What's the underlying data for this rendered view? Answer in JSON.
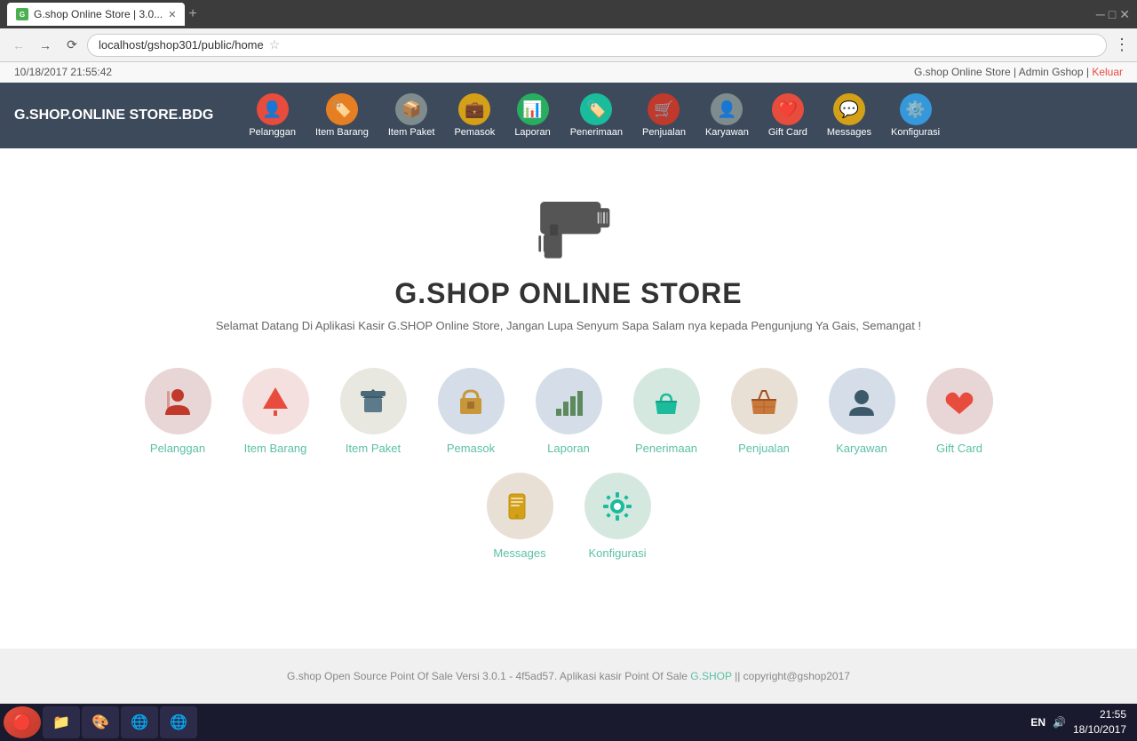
{
  "browser": {
    "tab_title": "G.shop Online Store | 3.0...",
    "tab_favicon": "G",
    "address": "localhost/gshop301/public/home"
  },
  "topbar": {
    "datetime": "10/18/2017 21:55:42",
    "site_info": "G.shop Online Store | Admin Gshop |",
    "logout_label": "Keluar"
  },
  "nav": {
    "brand": "G.SHOP.ONLINE STORE.BDG",
    "items": [
      {
        "id": "pelanggan",
        "label": "Pelanggan",
        "icon": "👤",
        "color": "#e74c3c"
      },
      {
        "id": "item-barang",
        "label": "Item Barang",
        "icon": "🏷️",
        "color": "#e67e22"
      },
      {
        "id": "item-paket",
        "label": "Item Paket",
        "icon": "📦",
        "color": "#7f8c8d"
      },
      {
        "id": "pemasok",
        "label": "Pemasok",
        "icon": "💼",
        "color": "#d4a017"
      },
      {
        "id": "laporan",
        "label": "Laporan",
        "icon": "📊",
        "color": "#2ecc71"
      },
      {
        "id": "penerimaan",
        "label": "Penerimaan",
        "icon": "🏷️",
        "color": "#1abc9c"
      },
      {
        "id": "penjualan",
        "label": "Penjualan",
        "icon": "🛒",
        "color": "#c0392b"
      },
      {
        "id": "karyawan",
        "label": "Karyawan",
        "icon": "👤",
        "color": "#7f8c8d"
      },
      {
        "id": "gift-card",
        "label": "Gift Card",
        "icon": "❤️",
        "color": "#e74c3c"
      },
      {
        "id": "messages",
        "label": "Messages",
        "icon": "💬",
        "color": "#d4a017"
      },
      {
        "id": "konfigurasi",
        "label": "Konfigurasi",
        "icon": "⚙️",
        "color": "#3498db"
      }
    ]
  },
  "main": {
    "store_title": "G.SHOP ONLINE STORE",
    "welcome_text": "Selamat Datang Di Aplikasi Kasir G.SHOP Online Store, Jangan Lupa Senyum Sapa Salam nya kepada Pengunjung Ya Gais, Semangat !",
    "menu_items": [
      {
        "id": "pelanggan",
        "label": "Pelanggan",
        "icon": "👤",
        "bg": "#e8d5d5"
      },
      {
        "id": "item-barang",
        "label": "Item Barang",
        "icon": "🏷️",
        "bg": "#f5e6e6"
      },
      {
        "id": "item-paket",
        "label": "Item Paket",
        "icon": "📦",
        "bg": "#e8e8e0"
      },
      {
        "id": "pemasok",
        "label": "Pemasok",
        "icon": "💼",
        "bg": "#d5dde8"
      },
      {
        "id": "laporan",
        "label": "Laporan",
        "icon": "📊",
        "bg": "#d5dde8"
      },
      {
        "id": "penerimaan",
        "label": "Penerimaan",
        "icon": "🛵",
        "bg": "#d5e8e0"
      },
      {
        "id": "penjualan",
        "label": "Penjualan",
        "icon": "🛒",
        "bg": "#e8e0d5"
      },
      {
        "id": "karyawan",
        "label": "Karyawan",
        "icon": "👤",
        "bg": "#d5dde8"
      },
      {
        "id": "gift-card",
        "label": "Gift Card",
        "icon": "❤️",
        "bg": "#e8d5d5"
      },
      {
        "id": "messages",
        "label": "Messages",
        "icon": "📱",
        "bg": "#e8e0d5"
      },
      {
        "id": "konfigurasi",
        "label": "Konfigurasi",
        "icon": "⚙️",
        "bg": "#d5e8e0"
      }
    ]
  },
  "footer": {
    "version_text": "G.shop Open Source Point Of Sale Versi 3.0.1 - 4f5ad57. Aplikasi kasir Point Of Sale",
    "brand_link": "G.SHOP",
    "copyright": "|| copyright@gshop2017"
  },
  "taskbar": {
    "lang": "EN",
    "time": "21:55",
    "date": "18/10/2017"
  },
  "colors": {
    "nav_bg": "#3d4a5c",
    "accent": "#5bc0a5",
    "footer_bg": "#f0f0f0"
  }
}
